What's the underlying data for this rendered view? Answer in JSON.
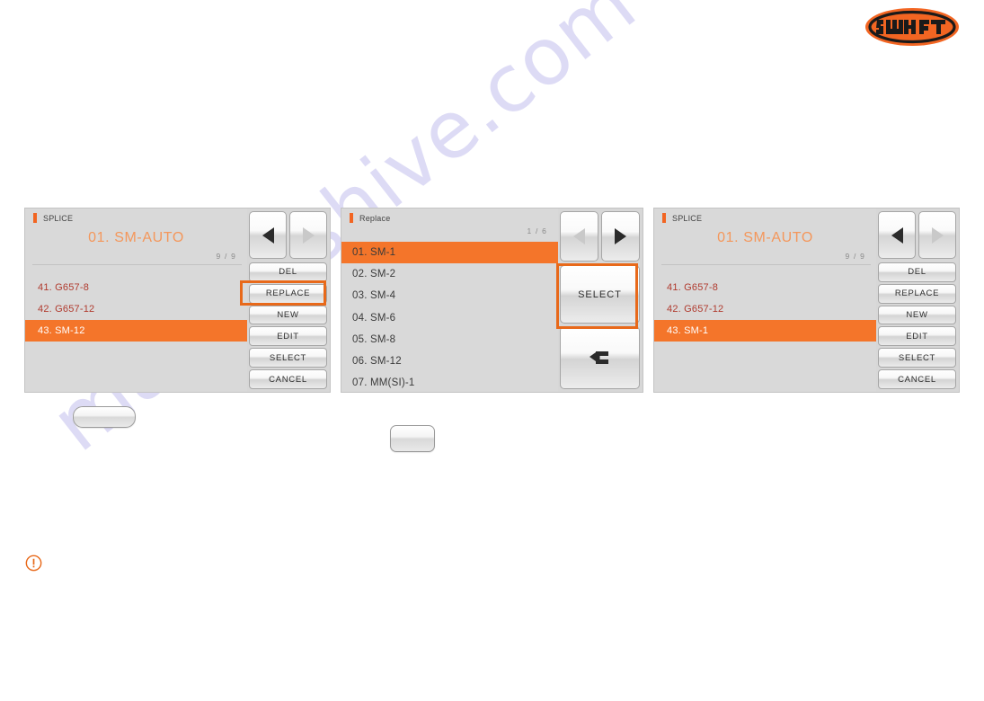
{
  "logo": {
    "brand": "SWIFT",
    "shape": "oval-badge",
    "color": "#f26522"
  },
  "watermark": {
    "text": "manualshive.com",
    "color": "#c9c6ef"
  },
  "notice": {
    "icon": "exclamation-circle-icon",
    "color": "#e8691a"
  },
  "blank_buttons": [
    {
      "name": "blank-button-1",
      "label": ""
    },
    {
      "name": "blank-button-2",
      "label": ""
    }
  ],
  "panels": [
    {
      "id": "panel-1",
      "title": "SPLICE",
      "mode_name": "01. SM-AUTO",
      "page_count": "9 / 9",
      "nav": {
        "prev_enabled": true,
        "next_enabled": false
      },
      "list": [
        {
          "label": "41. G657-8",
          "selected": false
        },
        {
          "label": "42. G657-12",
          "selected": false
        },
        {
          "label": "43. SM-12",
          "selected": true
        }
      ],
      "buttons": [
        {
          "label": "DEL",
          "highlighted": false
        },
        {
          "label": "REPLACE",
          "highlighted": true
        },
        {
          "label": "NEW",
          "highlighted": false
        },
        {
          "label": "EDIT",
          "highlighted": false
        },
        {
          "label": "SELECT",
          "highlighted": false
        },
        {
          "label": "CANCEL",
          "highlighted": false
        }
      ]
    },
    {
      "id": "panel-2",
      "title": "Replace",
      "page_count": "1 / 6",
      "nav": {
        "prev_enabled": false,
        "next_enabled": true
      },
      "list": [
        {
          "label": "01. SM-1",
          "selected": true
        },
        {
          "label": "02. SM-2",
          "selected": false
        },
        {
          "label": "03. SM-4",
          "selected": false
        },
        {
          "label": "04. SM-6",
          "selected": false
        },
        {
          "label": "05. SM-8",
          "selected": false
        },
        {
          "label": "06. SM-12",
          "selected": false
        },
        {
          "label": "07. MM(SI)-1",
          "selected": false
        }
      ],
      "select_button": {
        "label": "SELECT",
        "highlighted": true
      },
      "back_button": {
        "icon": "return-arrow-icon"
      }
    },
    {
      "id": "panel-3",
      "title": "SPLICE",
      "mode_name": "01. SM-AUTO",
      "page_count": "9 / 9",
      "nav": {
        "prev_enabled": true,
        "next_enabled": false
      },
      "list": [
        {
          "label": "41. G657-8",
          "selected": false
        },
        {
          "label": "42. G657-12",
          "selected": false
        },
        {
          "label": "43. SM-1",
          "selected": true
        }
      ],
      "buttons": [
        {
          "label": "DEL",
          "highlighted": false
        },
        {
          "label": "REPLACE",
          "highlighted": false
        },
        {
          "label": "NEW",
          "highlighted": false
        },
        {
          "label": "EDIT",
          "highlighted": false
        },
        {
          "label": "SELECT",
          "highlighted": false
        },
        {
          "label": "CANCEL",
          "highlighted": false
        }
      ]
    }
  ]
}
